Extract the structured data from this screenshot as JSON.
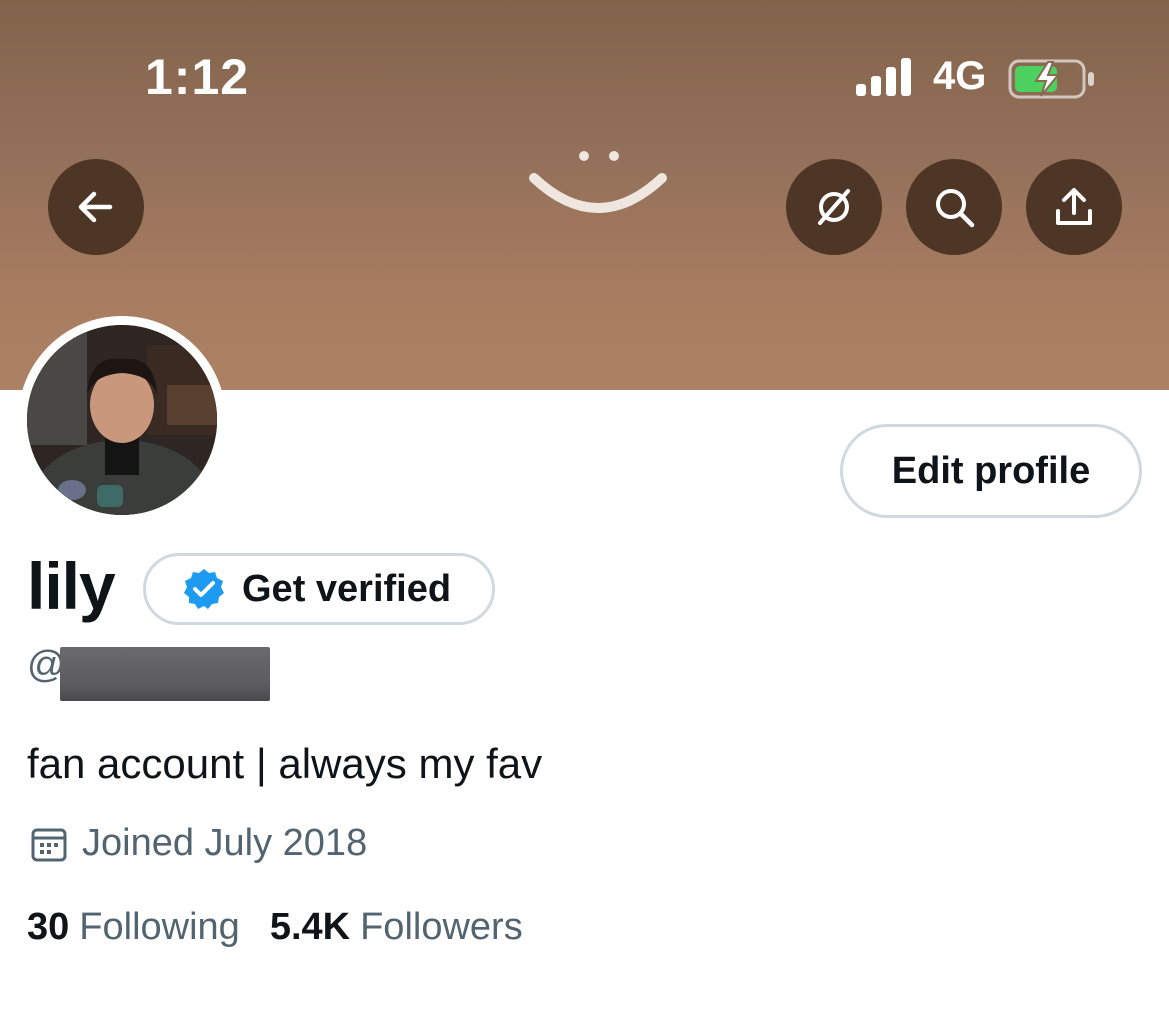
{
  "status_bar": {
    "time": "1:12",
    "network": "4G"
  },
  "header": {
    "back_icon": "arrow-left-icon",
    "actions": [
      "no-entry-icon",
      "search-icon",
      "share-icon"
    ]
  },
  "profile": {
    "name": "lily",
    "get_verified_label": "Get verified",
    "handle_prefix": "@",
    "bio": "fan account | always my fav",
    "joined": "Joined July 2018",
    "edit_profile_label": "Edit profile",
    "following_count": "30",
    "following_label": "Following",
    "followers_count": "5.4K",
    "followers_label": "Followers"
  },
  "colors": {
    "banner": "#93705a",
    "circle_button": "#4e3627",
    "verified_blue": "#1d9bf0",
    "text_primary": "#0f1419",
    "text_secondary": "#536471",
    "border": "#cfd9de"
  }
}
